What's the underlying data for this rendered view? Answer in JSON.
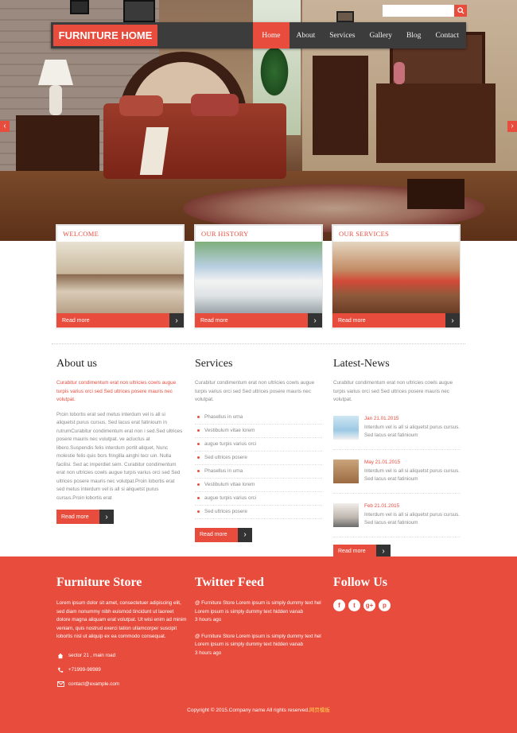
{
  "search": {
    "placeholder": ""
  },
  "header": {
    "logo": "FURNITURE HOME",
    "nav": [
      "Home",
      "About",
      "Services",
      "Gallery",
      "Blog",
      "Contact"
    ],
    "active": "Home"
  },
  "slider": {
    "prev": "‹",
    "next": "›"
  },
  "features": [
    {
      "title": "WELCOME",
      "button": "Read more"
    },
    {
      "title": "OUR HISTORY",
      "button": "Read more"
    },
    {
      "title": "OUR SERVICES",
      "button": "Read more"
    }
  ],
  "about": {
    "heading": "About us",
    "lead": "Curabitur condimentum erat non ultricies cowls augue turpis varius orci sed Sed ultrices posere mauris nec volutpat.",
    "body": "Proin lobortis erat sed metus interdum vel is all si aliquetst purus cursus. Sed lacus erat fatinioum in rutrumCurabitur condimentum erat non i sed.Sed ultrices posere mauris nec volutpat. ve acluctus at libero.Suspendis felis interdum portit aliquet. Nunc molestie felis quis bors fringilla ainghi tecr uin. Nulla facilisi. Sed ac imperdiet sem. Curabitur condimentum erat non ultricies cowls augue turpis varius orci sed Sed ultrices posere mauris nec volutpat.Proin lobortis erat sed metus interdum vel is all si aliquetst purus cursus.Proin lobortis erat",
    "button": "Read more"
  },
  "services": {
    "heading": "Services",
    "lead": "Curabitur condimentum erat non ultricies cowls augue turpis varius orci sed Sed ultrices posere mauris nec volutpat.",
    "items": [
      "Phasellus in urna",
      "Vestibulum vitae lorem",
      "augue turpis varius orci",
      "Sed ultrices posere",
      "Phasellus in urna",
      "Vestibulum vitae lorem",
      "augue turpis varius orci",
      "Sed ultrices posere"
    ],
    "button": "Read more"
  },
  "news": {
    "heading": "Latest-News",
    "lead": "Curabitur condimentum erat non ultricies cowls augue turpis varius orci sed Sed ultrices posere mauris nec volutpat.",
    "items": [
      {
        "date": "Jan 21.01.2015",
        "text": "Interdum vel is all si aliquetst purus cursus. Sed lacus erat fatinioum"
      },
      {
        "date": "May 21.01.2015",
        "text": "Interdum vel is all si aliquetst purus cursus. Sed lacus erat fatinioum"
      },
      {
        "date": "Feb 21.01.2015",
        "text": "Interdum vel is all si aliquetst purus cursus. Sed lacus erat fatinioum"
      }
    ],
    "button": "Read more"
  },
  "footer": {
    "store": {
      "heading": "Furniture Store",
      "text": "Lorem ipsum dolor sit amet, consectetuer adipiscing elit, sed diam nonummy nibh euismod tincidunt ut laoreet dolore magna aliquam erat volutpat. Ut wisi enim ad minim veniam, quis nostrud exerci tation ullamcorper suscipit lobortis nisl ut aliquip ex ea commodo consequat.",
      "address": "sector 21 , main road",
      "phone": "+71999-98989",
      "email": "contact@example.com"
    },
    "twitter": {
      "heading": "Twitter Feed",
      "tweets": [
        {
          "text": "@ Furniture Store Lorem ipsum is simply dummy text hel Lorem ipsum is simply dummy text hidden vanab",
          "time": "3 hours ago"
        },
        {
          "text": "@ Furniture Store Lorem ipsum is simply dummy text hel Lorem ipsum is simply dummy text hidden vanab",
          "time": "3 hours ago"
        }
      ]
    },
    "follow": {
      "heading": "Follow Us",
      "icons": [
        "f",
        "t",
        "g+",
        "p"
      ]
    },
    "copyright": "Copyright © 2015.Company name All rights reserved.",
    "copyright_link": "网页模板"
  }
}
